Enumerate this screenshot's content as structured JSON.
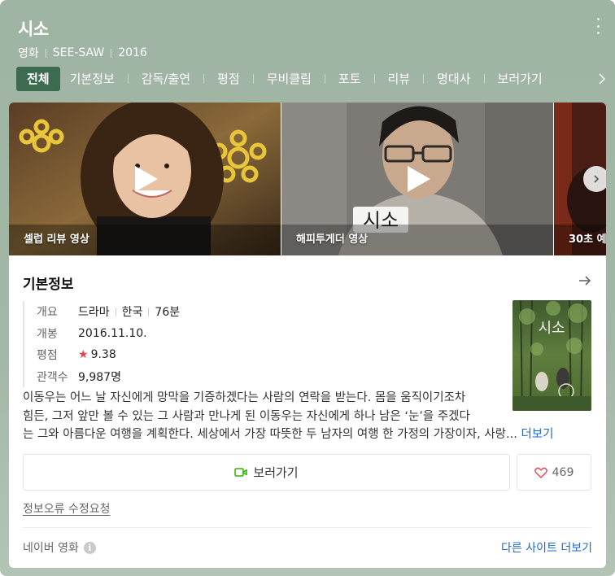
{
  "header": {
    "title": "시소",
    "meta": [
      "영화",
      "SEE-SAW",
      "2016"
    ]
  },
  "tabs": [
    {
      "label": "전체",
      "active": true
    },
    {
      "label": "기본정보"
    },
    {
      "label": "감독/출연"
    },
    {
      "label": "평점"
    },
    {
      "label": "무비클립"
    },
    {
      "label": "포토"
    },
    {
      "label": "리뷰"
    },
    {
      "label": "명대사"
    },
    {
      "label": "보러가기"
    }
  ],
  "videos": [
    {
      "label": "셀럽 리뷰 영상"
    },
    {
      "label": "해피투게더 영상"
    },
    {
      "label": "30초 예고"
    }
  ],
  "basic_info": {
    "section_title": "기본정보",
    "rows": {
      "overview": {
        "key": "개요",
        "genre": "드라마",
        "country": "한국",
        "runtime": "76분"
      },
      "release": {
        "key": "개봉",
        "value": "2016.11.10."
      },
      "rating": {
        "key": "평점",
        "value": "9.38"
      },
      "audience": {
        "key": "관객수",
        "value": "9,987명"
      }
    },
    "poster": {
      "title": "시소"
    },
    "synopsis": {
      "line1": "이동우는 어느 날 자신에게 망막을 기증하겠다는 사람의 연락을 받는다. 몸을 움직이기조차",
      "line2": "힘든, 그저 앞만 볼 수 있는 그 사람과 만나게 된 이동우는 자신에게 하나 남은 ‘눈’을 주겠다",
      "line3": "는 그와 아름다운 여행을 계획한다. 세상에서 가장 따뜻한 두 남자의 여행 한 가정의 가장이자, 사랑...",
      "more": "더보기"
    }
  },
  "actions": {
    "watch_label": "보러가기",
    "like_count": "469"
  },
  "footer": {
    "report_label": "정보오류 수정요청",
    "source_label": "네이버 영화",
    "other_sites_label": "다른 사이트 더보기"
  },
  "colors": {
    "header_bg": "#a3b7a7",
    "active_tab": "#3d6b4f",
    "link": "#1c69c9",
    "star": "#e6424f",
    "watch_icon": "#2db400"
  },
  "icons": [
    "more-vertical-icon",
    "chevron-right-icon",
    "play-icon",
    "arrow-right-icon",
    "star-icon",
    "video-camera-icon",
    "heart-icon",
    "info-icon"
  ]
}
